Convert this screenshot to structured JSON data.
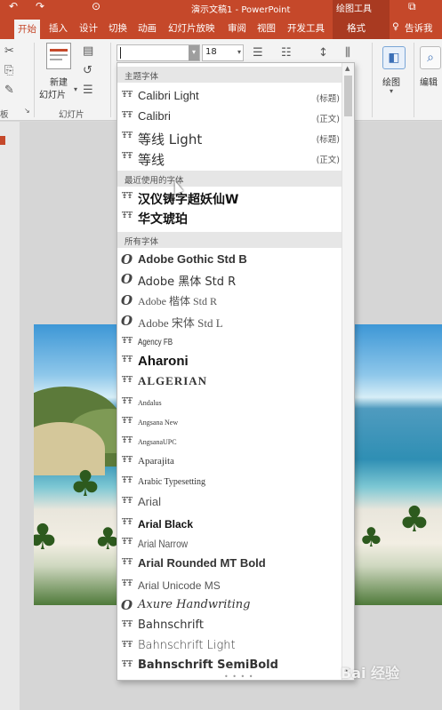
{
  "titlebar": {
    "document_title": "演示文稿1 - PowerPoint",
    "contextual_group": "绘图工具",
    "undo_icon": "undo-icon",
    "redo_icon": "redo-icon",
    "restore_icon": "restore-window-icon"
  },
  "tabs": [
    {
      "label": "开始",
      "active": true
    },
    {
      "label": "插入"
    },
    {
      "label": "设计"
    },
    {
      "label": "切换"
    },
    {
      "label": "动画"
    },
    {
      "label": "幻灯片放映"
    },
    {
      "label": "审阅"
    },
    {
      "label": "视图"
    },
    {
      "label": "开发工具"
    },
    {
      "label": "格式"
    }
  ],
  "tell_me": "告诉我",
  "ribbon": {
    "clipboard_label": "板",
    "new_slide_line1": "新建",
    "new_slide_line2": "幻灯片",
    "slides_group_label": "幻灯片",
    "font_name_value": "",
    "font_size_value": "18",
    "drawing_label": "绘图",
    "editing_label": "编辑"
  },
  "dropdown": {
    "section_theme": "主题字体",
    "theme_fonts": [
      {
        "name": "Calibri Light",
        "tag": "(标题)"
      },
      {
        "name": "Calibri",
        "tag": "(正文)"
      },
      {
        "name": "等线 Light",
        "tag": "(标题)"
      },
      {
        "name": "等线",
        "tag": "(正文)"
      }
    ],
    "section_recent": "最近使用的字体",
    "recent_fonts": [
      {
        "name": "汉仪铸字超妖仙W"
      },
      {
        "name": "华文琥珀"
      }
    ],
    "section_all": "所有字体",
    "all_fonts": [
      {
        "name": "Adobe Gothic Std B",
        "type": "opentype"
      },
      {
        "name": "Adobe 黑体 Std R",
        "type": "opentype"
      },
      {
        "name": "Adobe 楷体 Std R",
        "type": "opentype"
      },
      {
        "name": "Adobe 宋体 Std L",
        "type": "opentype"
      },
      {
        "name": "Agency FB",
        "type": "truetype"
      },
      {
        "name": "Aharoni",
        "type": "truetype"
      },
      {
        "name": "ALGERIAN",
        "type": "truetype"
      },
      {
        "name": "Andalus",
        "type": "truetype"
      },
      {
        "name": "Angsana New",
        "type": "truetype"
      },
      {
        "name": "AngsanaUPC",
        "type": "truetype"
      },
      {
        "name": "Aparajita",
        "type": "truetype"
      },
      {
        "name": "Arabic Typesetting",
        "type": "truetype"
      },
      {
        "name": "Arial",
        "type": "truetype"
      },
      {
        "name": "Arial Black",
        "type": "truetype"
      },
      {
        "name": "Arial Narrow",
        "type": "truetype"
      },
      {
        "name": "Arial Rounded MT Bold",
        "type": "truetype"
      },
      {
        "name": "Arial Unicode MS",
        "type": "truetype"
      },
      {
        "name": "Axure Handwriting",
        "type": "opentype"
      },
      {
        "name": "Bahnschrift",
        "type": "truetype"
      },
      {
        "name": "Bahnschrift Light",
        "type": "truetype"
      },
      {
        "name": "Bahnschrift SemiBold",
        "type": "truetype"
      }
    ]
  },
  "watermark": "Bai 经验",
  "colors": {
    "accent": "#c5482a",
    "contextual": "#a93a21",
    "ribbon_bg": "#f3f3f3"
  }
}
